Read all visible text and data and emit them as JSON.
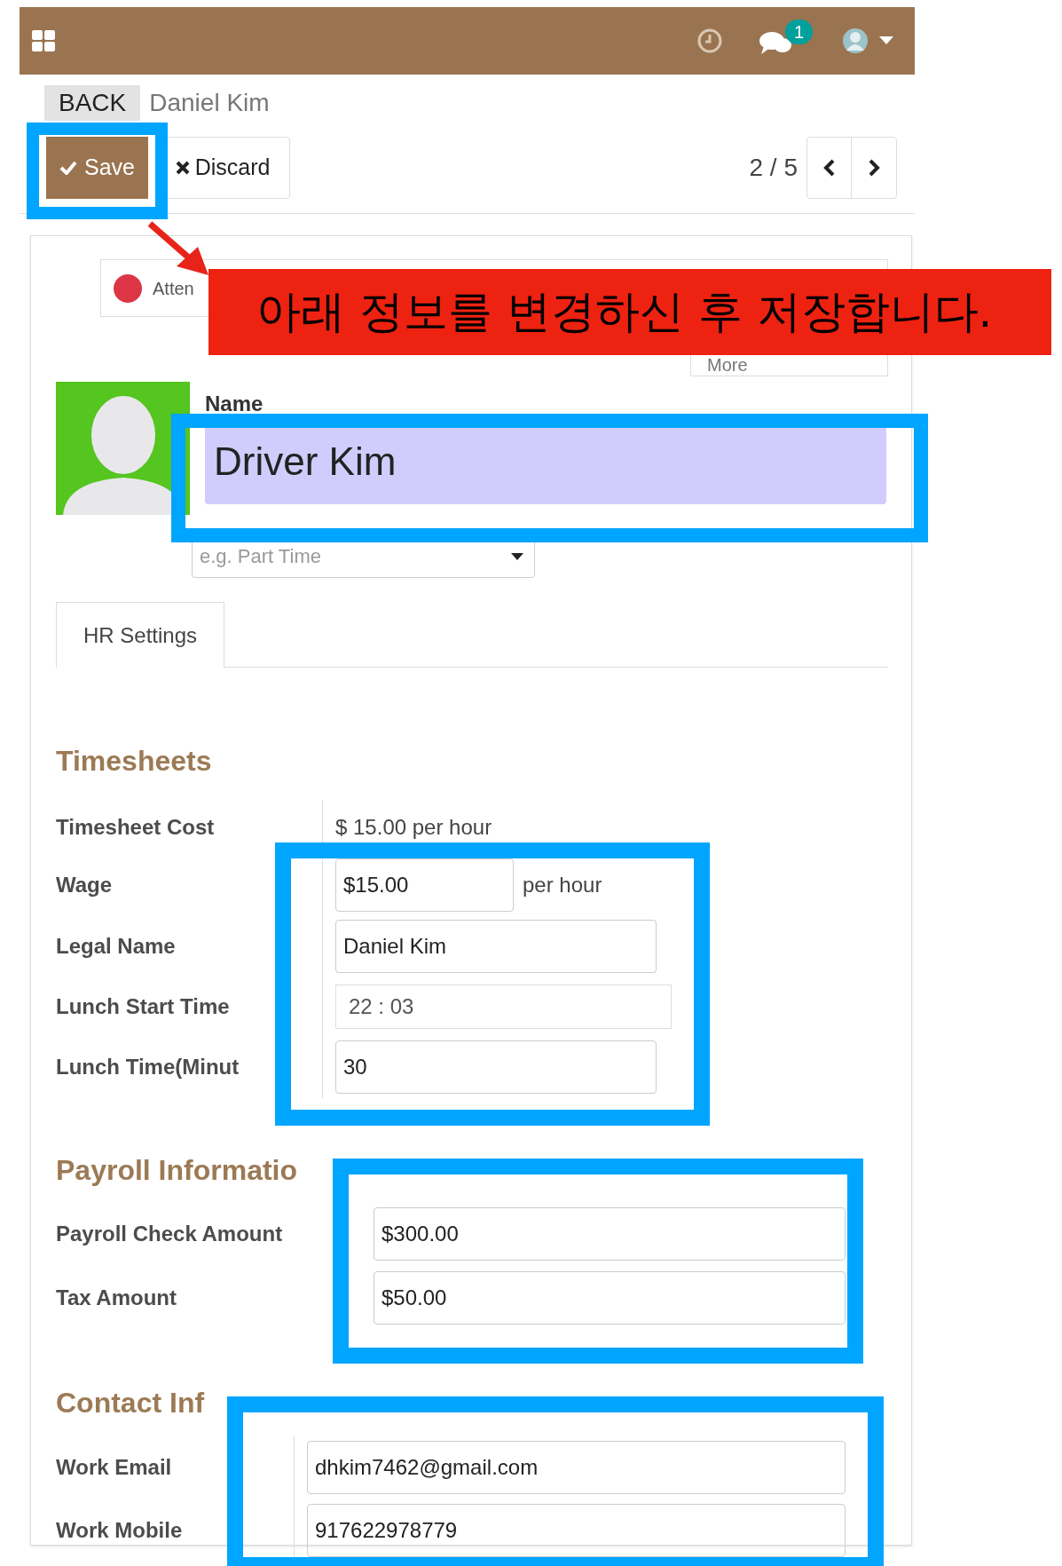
{
  "top_bar": {
    "message_count": "1"
  },
  "breadcrumb": {
    "back": "BACK",
    "current": "Daniel Kim"
  },
  "toolbar": {
    "save": "Save",
    "discard": "Discard",
    "pager": "2 / 5"
  },
  "stat_buttons": [
    {
      "label": "Atten",
      "color": "#dc3545"
    }
  ],
  "more_button": "More",
  "employee": {
    "name_label": "Name",
    "name": "Driver Kim",
    "job_placeholder": "e.g. Part Time"
  },
  "tabs": [
    {
      "label": "HR Settings",
      "selected": true
    }
  ],
  "sections": [
    {
      "title": "Timesheets",
      "divider": true,
      "fields": [
        {
          "kind": "readonly",
          "label": "Timesheet Cost",
          "value": "$ 15.00 per hour"
        },
        {
          "kind": "unit",
          "label": "Wage",
          "value": "$15.00",
          "unit": "per hour"
        },
        {
          "kind": "input",
          "label": "Legal Name",
          "value": "Daniel Kim"
        },
        {
          "kind": "time",
          "label": "Lunch Start Time",
          "value": "22 : 03"
        },
        {
          "kind": "input",
          "label": "Lunch Time(Minut",
          "value": "30"
        }
      ]
    },
    {
      "title": "Payroll Informatio",
      "divider": false,
      "fields": [
        {
          "kind": "wide",
          "label": "Payroll Check Amount",
          "value": "$300.00"
        },
        {
          "kind": "wide",
          "label": "Tax Amount",
          "value": "$50.00"
        }
      ]
    },
    {
      "title": "Contact Inf",
      "divider": true,
      "fields": [
        {
          "kind": "contact",
          "label": "Work Email",
          "value": "dhkim7462@gmail.com"
        },
        {
          "kind": "contact",
          "label": "Work Mobile",
          "value": "917622978779"
        }
      ]
    }
  ],
  "annotation": {
    "callout": "아래 정보를 변경하신 후 저장합니다."
  }
}
